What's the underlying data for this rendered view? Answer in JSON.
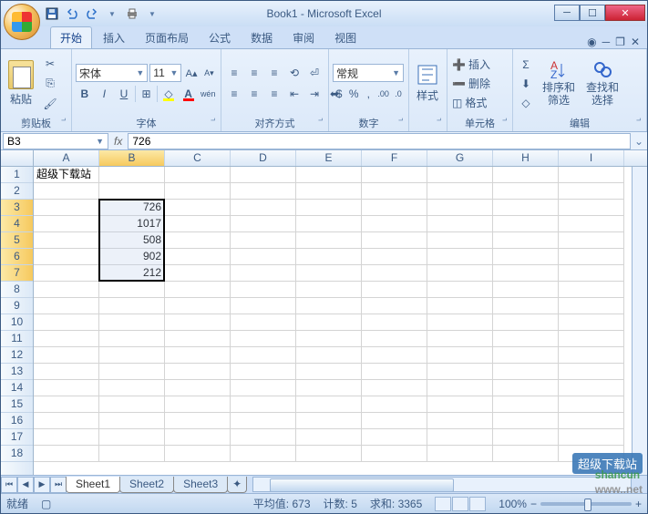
{
  "title": "Book1 - Microsoft Excel",
  "qat_icons": [
    "save-icon",
    "undo-icon",
    "redo-icon",
    "print-icon"
  ],
  "tabs": {
    "items": [
      "开始",
      "插入",
      "页面布局",
      "公式",
      "数据",
      "审阅",
      "视图"
    ],
    "active": 0
  },
  "ribbon": {
    "clipboard": {
      "label": "剪贴板",
      "paste": "粘贴"
    },
    "font": {
      "label": "字体",
      "name": "宋体",
      "size": "11"
    },
    "alignment": {
      "label": "对齐方式"
    },
    "number": {
      "label": "数字",
      "format": "常规"
    },
    "styles": {
      "label": "",
      "btn": "样式"
    },
    "cells": {
      "label": "单元格",
      "insert": "插入",
      "delete": "删除",
      "format": "格式"
    },
    "editing": {
      "label": "编辑",
      "sort": "排序和\n筛选",
      "find": "查找和\n选择"
    }
  },
  "namebox": "B3",
  "formula": "726",
  "columns": [
    "A",
    "B",
    "C",
    "D",
    "E",
    "F",
    "G",
    "H",
    "I"
  ],
  "rows_visible": 18,
  "data": {
    "A1": "超级下载站",
    "B3": "726",
    "B4": "1017",
    "B5": "508",
    "B6": "902",
    "B7": "212"
  },
  "selection": {
    "col": 1,
    "row_start": 2,
    "row_end": 6
  },
  "sheets": {
    "items": [
      "Sheet1",
      "Sheet2",
      "Sheet3"
    ],
    "active": 0
  },
  "status": {
    "ready": "就绪",
    "avg_label": "平均值:",
    "avg": "673",
    "count_label": "计数:",
    "count": "5",
    "sum_label": "求和:",
    "sum": "3365",
    "zoom": "100%"
  },
  "watermark": {
    "top": "超级下载站",
    "main": "shancun",
    "sub": ".net",
    "prefix": "www."
  }
}
